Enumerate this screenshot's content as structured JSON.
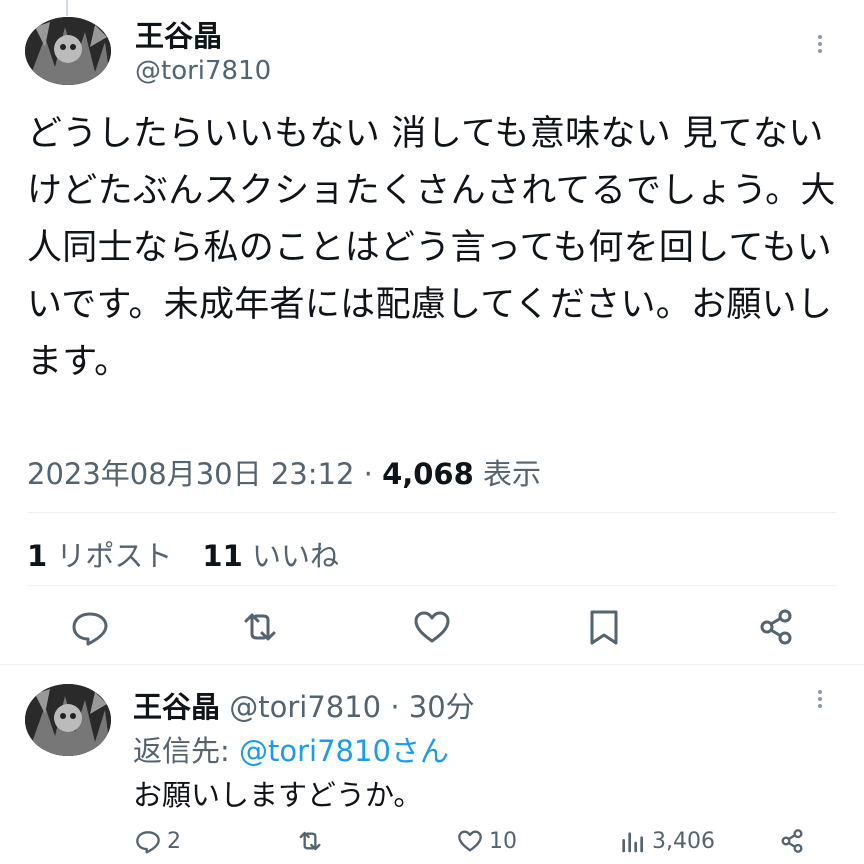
{
  "tweet": {
    "author_name": "王谷晶",
    "author_handle": "@tori7810",
    "text": "どうしたらいいもない 消しても意味ない 見てないけどたぶんスクショたくさんされてるでしょう。大人同士なら私のことはどう言っても何を回してもいいです。未成年者には配慮してください。お願いします。",
    "timestamp": "2023年08月30日 23:12 · ",
    "views": "4,068",
    "views_label": " 表示",
    "reposts": "1",
    "reposts_label": " リポスト",
    "likes": "11",
    "likes_label": " いいね"
  },
  "reply": {
    "author_name": "王谷晶",
    "meta": " @tori7810 · 30分",
    "reply_to_prefix": "返信先: ",
    "reply_to_handle": "@tori7810さん",
    "text": "お願いしますどうか。",
    "replies_count": "2",
    "likes_count": "10",
    "views_count": "3,406"
  },
  "icons": {
    "reply": "speech-bubble-icon",
    "repost": "repost-arrows-icon",
    "like": "heart-icon",
    "bookmark": "bookmark-icon",
    "share": "share-icon",
    "views": "bar-chart-icon",
    "more": "more-vertical-icon"
  },
  "colors": {
    "link": "#1d9bf0",
    "muted": "#536471",
    "text": "#0f1419"
  }
}
